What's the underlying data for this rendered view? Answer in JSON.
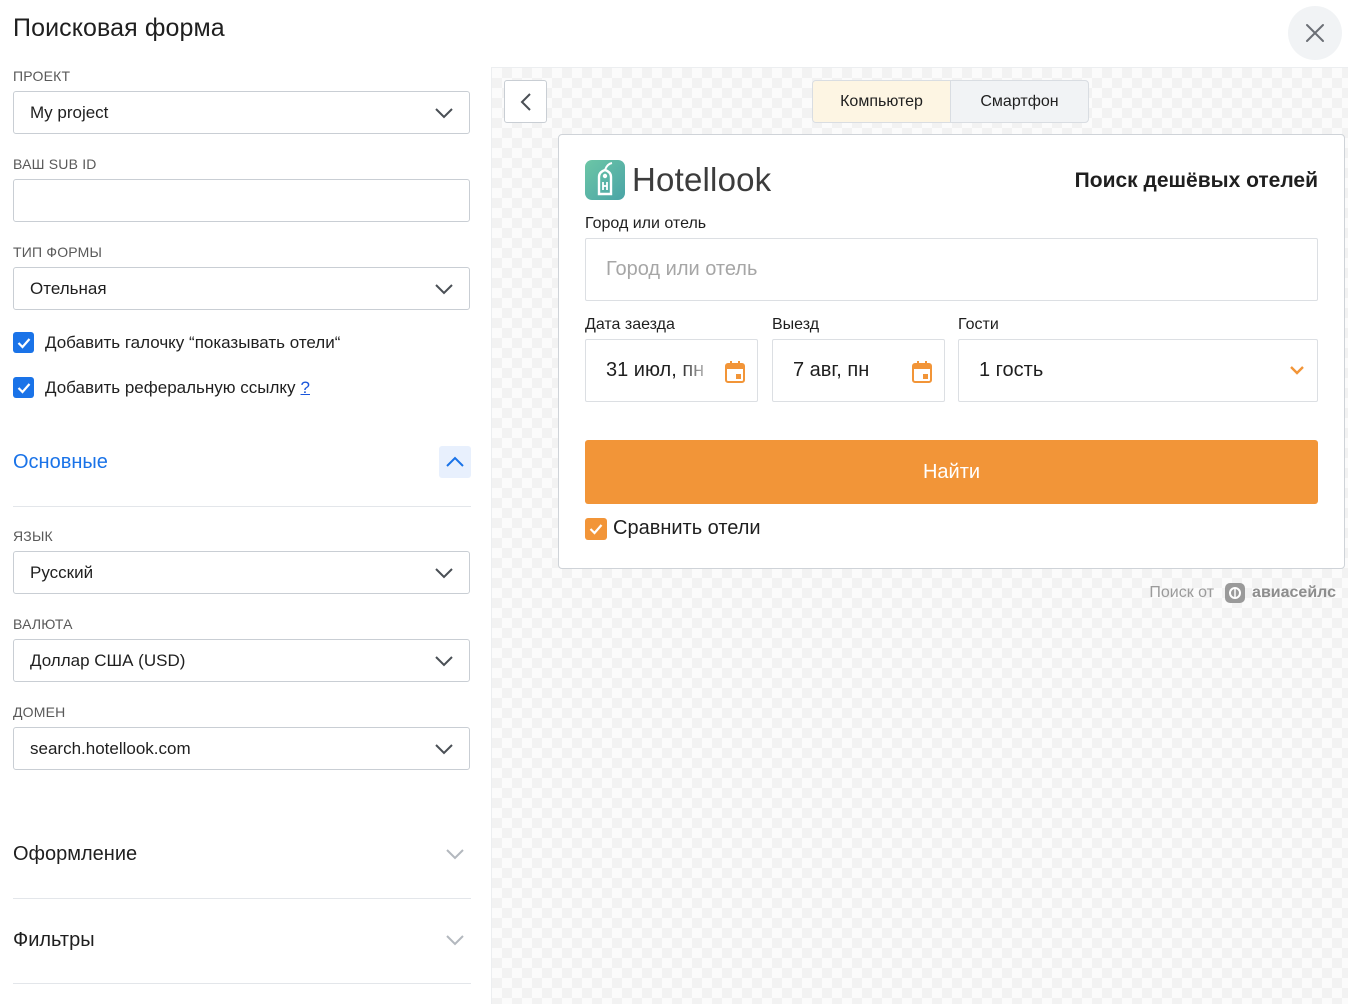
{
  "page": {
    "title": "Поисковая форма"
  },
  "form": {
    "project": {
      "label": "ПРОЕКТ",
      "value": "My project"
    },
    "sub_id": {
      "label": "ВАШ SUB ID",
      "value": ""
    },
    "form_type": {
      "label": "ТИП ФОРМЫ",
      "value": "Отельная"
    },
    "checkbox_show_hotels": {
      "label": "Добавить галочку “показывать отели“",
      "checked": true
    },
    "checkbox_referral": {
      "label": "Добавить реферальную ссылку",
      "help": "?",
      "checked": true
    },
    "sections": {
      "basic": {
        "title": "Основные",
        "expanded": true
      },
      "design": {
        "title": "Оформление",
        "expanded": false
      },
      "filters": {
        "title": "Фильтры",
        "expanded": false
      }
    },
    "language": {
      "label": "ЯЗЫК",
      "value": "Русский"
    },
    "currency": {
      "label": "ВАЛЮТА",
      "value": "Доллар США (USD)"
    },
    "domain": {
      "label": "ДОМЕН",
      "value": "search.hotellook.com"
    }
  },
  "preview": {
    "device_tabs": [
      {
        "label": "Компьютер",
        "active": true
      },
      {
        "label": "Смартфон",
        "active": false
      }
    ],
    "widget": {
      "brand": "Hotellook",
      "title": "Поиск дешёвых отелей",
      "city_label": "Город или отель",
      "city_placeholder": "Город или отель",
      "checkin_label": "Дата заезда",
      "checkin_value": "31 июл, пн",
      "checkout_label": "Выезд",
      "checkout_value": "7 авг, пн",
      "guests_label": "Гости",
      "guests_value": "1 гость",
      "search_button": "Найти",
      "compare_label": "Сравнить отели",
      "compare_checked": true
    },
    "powered_by": {
      "text": "Поиск от",
      "brand": "авиасейлс"
    }
  },
  "colors": {
    "accent_blue": "#1a73e8",
    "accent_orange": "#f29538",
    "brand_green": "#5fb8a0"
  }
}
